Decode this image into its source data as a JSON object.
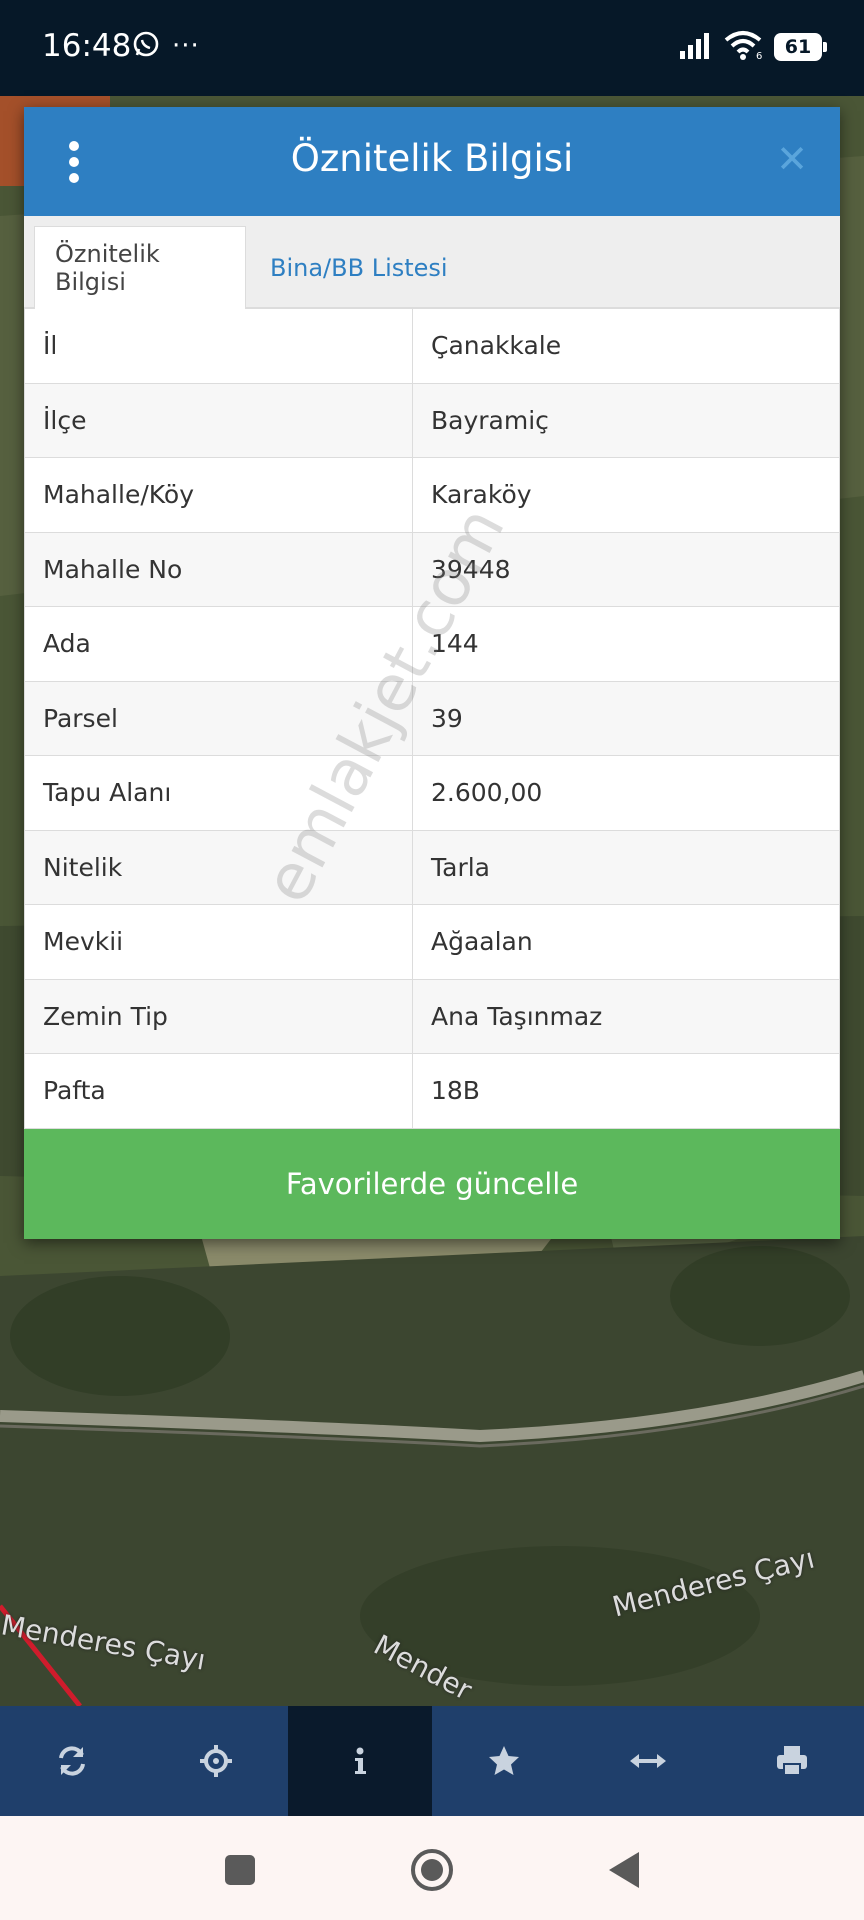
{
  "status_bar": {
    "time": "16:48",
    "more_indicator": "···",
    "battery_level": "61",
    "icons": [
      "whatsapp-icon",
      "signal-icon",
      "wifi-icon",
      "battery-icon"
    ]
  },
  "map": {
    "labels": [
      "Menderes Çayı",
      "Menderes Çayı",
      "Mender"
    ]
  },
  "dialog": {
    "title": "Öznitelik Bilgisi",
    "tabs": [
      {
        "label": "Öznitelik Bilgisi",
        "active": true
      },
      {
        "label": "Bina/BB Listesi",
        "active": false
      }
    ],
    "rows": [
      {
        "label": "İl",
        "value": "Çanakkale"
      },
      {
        "label": "İlçe",
        "value": "Bayramiç"
      },
      {
        "label": "Mahalle/Köy",
        "value": "Karaköy"
      },
      {
        "label": "Mahalle No",
        "value": "39448"
      },
      {
        "label": "Ada",
        "value": "144"
      },
      {
        "label": "Parsel",
        "value": "39"
      },
      {
        "label": "Tapu Alanı",
        "value": "2.600,00"
      },
      {
        "label": "Nitelik",
        "value": "Tarla"
      },
      {
        "label": "Mevkii",
        "value": "Ağaalan"
      },
      {
        "label": "Zemin Tip",
        "value": "Ana Taşınmaz"
      },
      {
        "label": "Pafta",
        "value": "18B"
      }
    ],
    "update_button": "Favorilerde güncelle"
  },
  "watermark": "emlakjet.com",
  "toolbar": {
    "items": [
      "refresh-icon",
      "locate-icon",
      "info-icon",
      "star-icon",
      "measure-icon",
      "print-icon"
    ],
    "active_index": 2
  },
  "colors": {
    "header_blue": "#2e7fc2",
    "button_green": "#5cb85c",
    "toolbar_blue": "#1f3f6b",
    "toolbar_active": "#0a1a2c",
    "status_bar": "#061828"
  }
}
